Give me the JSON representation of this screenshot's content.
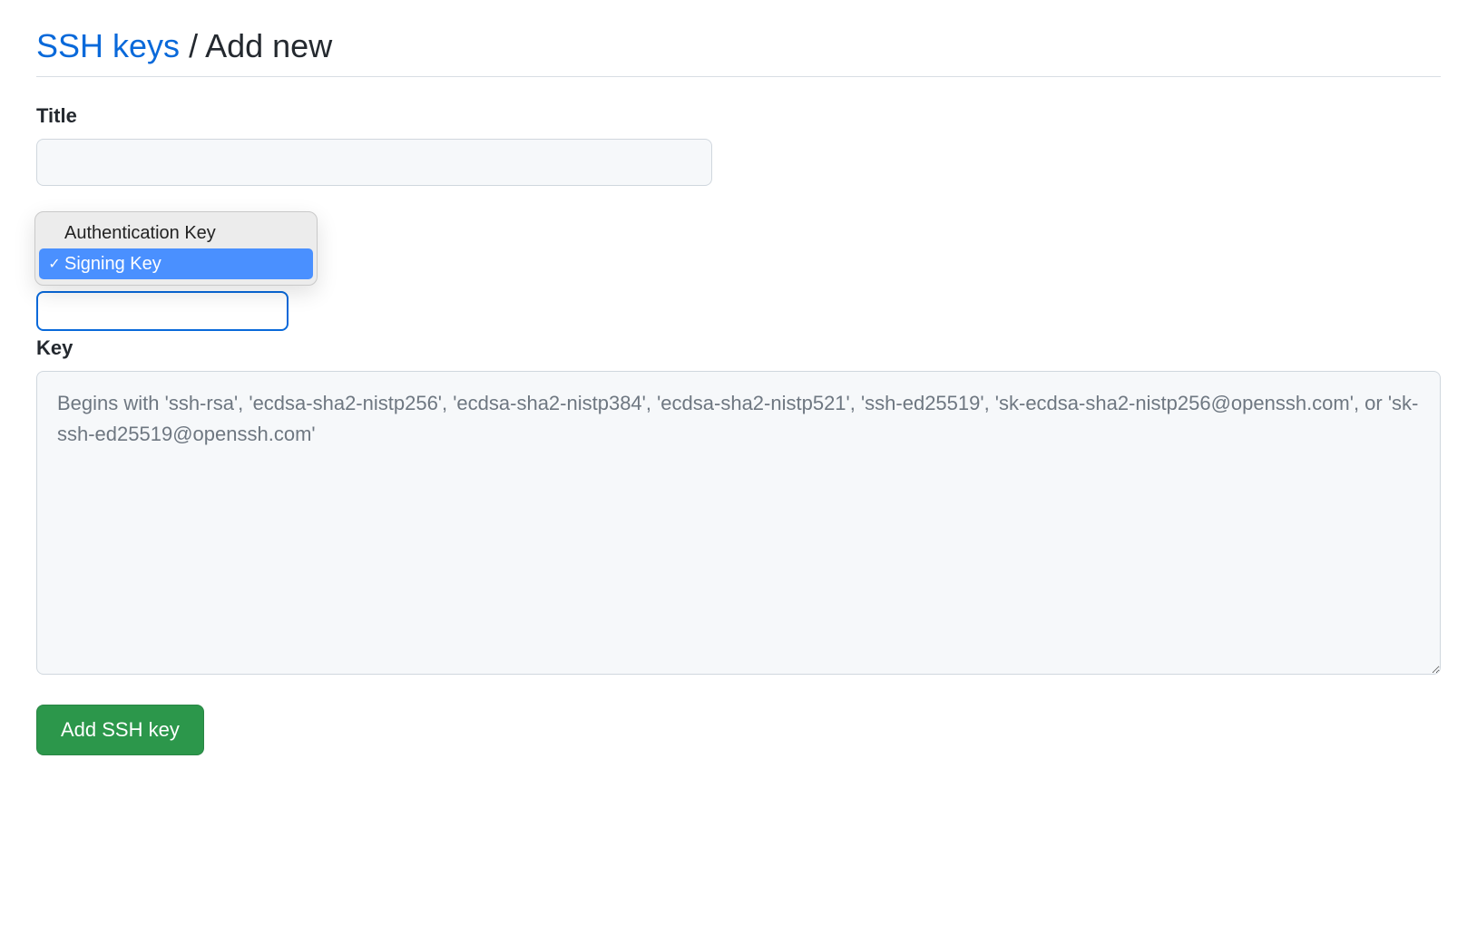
{
  "breadcrumb": {
    "parent": "SSH keys",
    "separator": "/",
    "current": "Add new"
  },
  "form": {
    "title_label": "Title",
    "title_value": "",
    "key_type": {
      "options": [
        {
          "label": "Authentication Key",
          "selected": false
        },
        {
          "label": "Signing Key",
          "selected": true
        }
      ]
    },
    "key_label": "Key",
    "key_placeholder": "Begins with 'ssh-rsa', 'ecdsa-sha2-nistp256', 'ecdsa-sha2-nistp384', 'ecdsa-sha2-nistp521', 'ssh-ed25519', 'sk-ecdsa-sha2-nistp256@openssh.com', or 'sk-ssh-ed25519@openssh.com'",
    "key_value": "",
    "submit_label": "Add SSH key"
  }
}
